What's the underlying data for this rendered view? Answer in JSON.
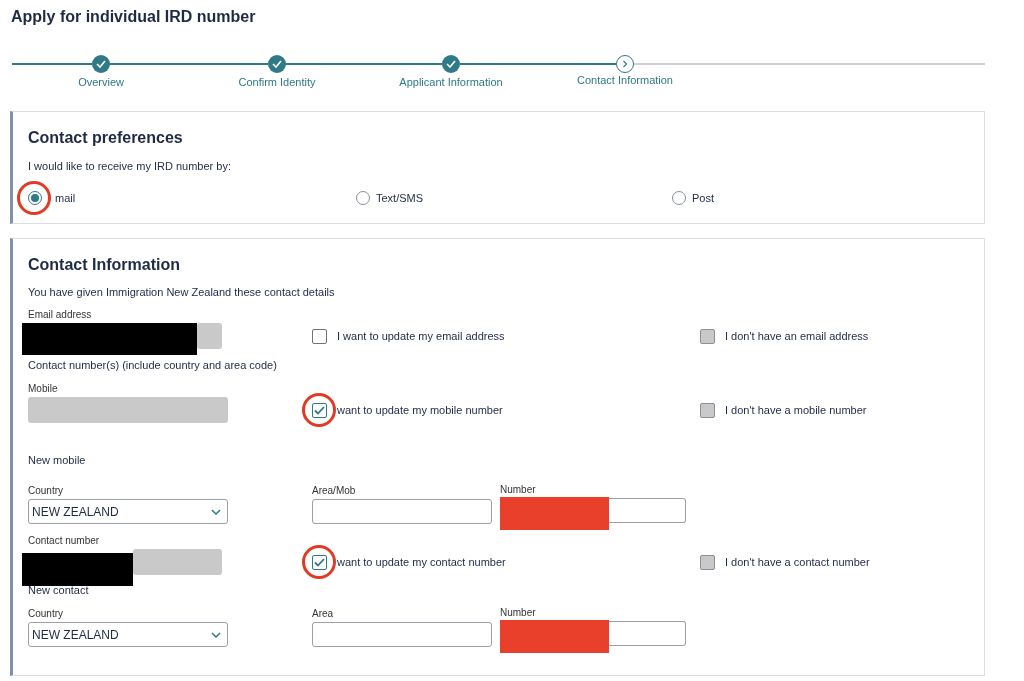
{
  "title": "Apply for individual IRD number",
  "steps": [
    {
      "label": "Overview",
      "completed": true,
      "selected": false
    },
    {
      "label": "Confirm Identity",
      "completed": true,
      "selected": false
    },
    {
      "label": "Applicant Information",
      "completed": true,
      "selected": false
    },
    {
      "label": "Contact Information",
      "completed": false,
      "selected": true
    }
  ],
  "preferences": {
    "heading": "Contact preferences",
    "prompt": "I would like to receive my IRD number by:",
    "options": [
      {
        "label": "mail",
        "selected": true,
        "highlighted": true
      },
      {
        "label": "Text/SMS",
        "selected": false,
        "highlighted": false
      },
      {
        "label": "Post",
        "selected": false,
        "highlighted": false
      }
    ]
  },
  "contact": {
    "heading": "Contact Information",
    "intro": "You have given Immigration New Zealand these contact details",
    "email": {
      "label": "Email address",
      "redacted": true,
      "update": {
        "label": "I want to update my email address",
        "checked": false,
        "highlighted": false
      },
      "none": {
        "label": "I don't have an email address",
        "checked": false,
        "disabled": true
      }
    },
    "numbers_label": "Contact number(s) (include country and area code)",
    "mobile": {
      "label": "Mobile",
      "redacted": false,
      "update": {
        "label": "want to update my mobile number",
        "checked": true,
        "highlighted": true
      },
      "none": {
        "label": "I don't have a mobile number",
        "checked": false,
        "disabled": true
      }
    },
    "new_mobile": {
      "heading": "New mobile",
      "country": {
        "label": "Country",
        "value": "NEW ZEALAND"
      },
      "area": {
        "label": "Area/Mob"
      },
      "number": {
        "label": "Number",
        "redacted": true
      }
    },
    "contact_number": {
      "label": "Contact number",
      "redacted": true,
      "update": {
        "label": "want to update my contact number",
        "checked": true,
        "highlighted": true
      },
      "none": {
        "label": "I don't have a contact number",
        "checked": false,
        "disabled": true
      }
    },
    "new_contact": {
      "heading": "New contact",
      "country": {
        "label": "Country",
        "value": "NEW ZEALAND"
      },
      "area": {
        "label": "Area"
      },
      "number": {
        "label": "Number",
        "redacted": true
      }
    }
  }
}
